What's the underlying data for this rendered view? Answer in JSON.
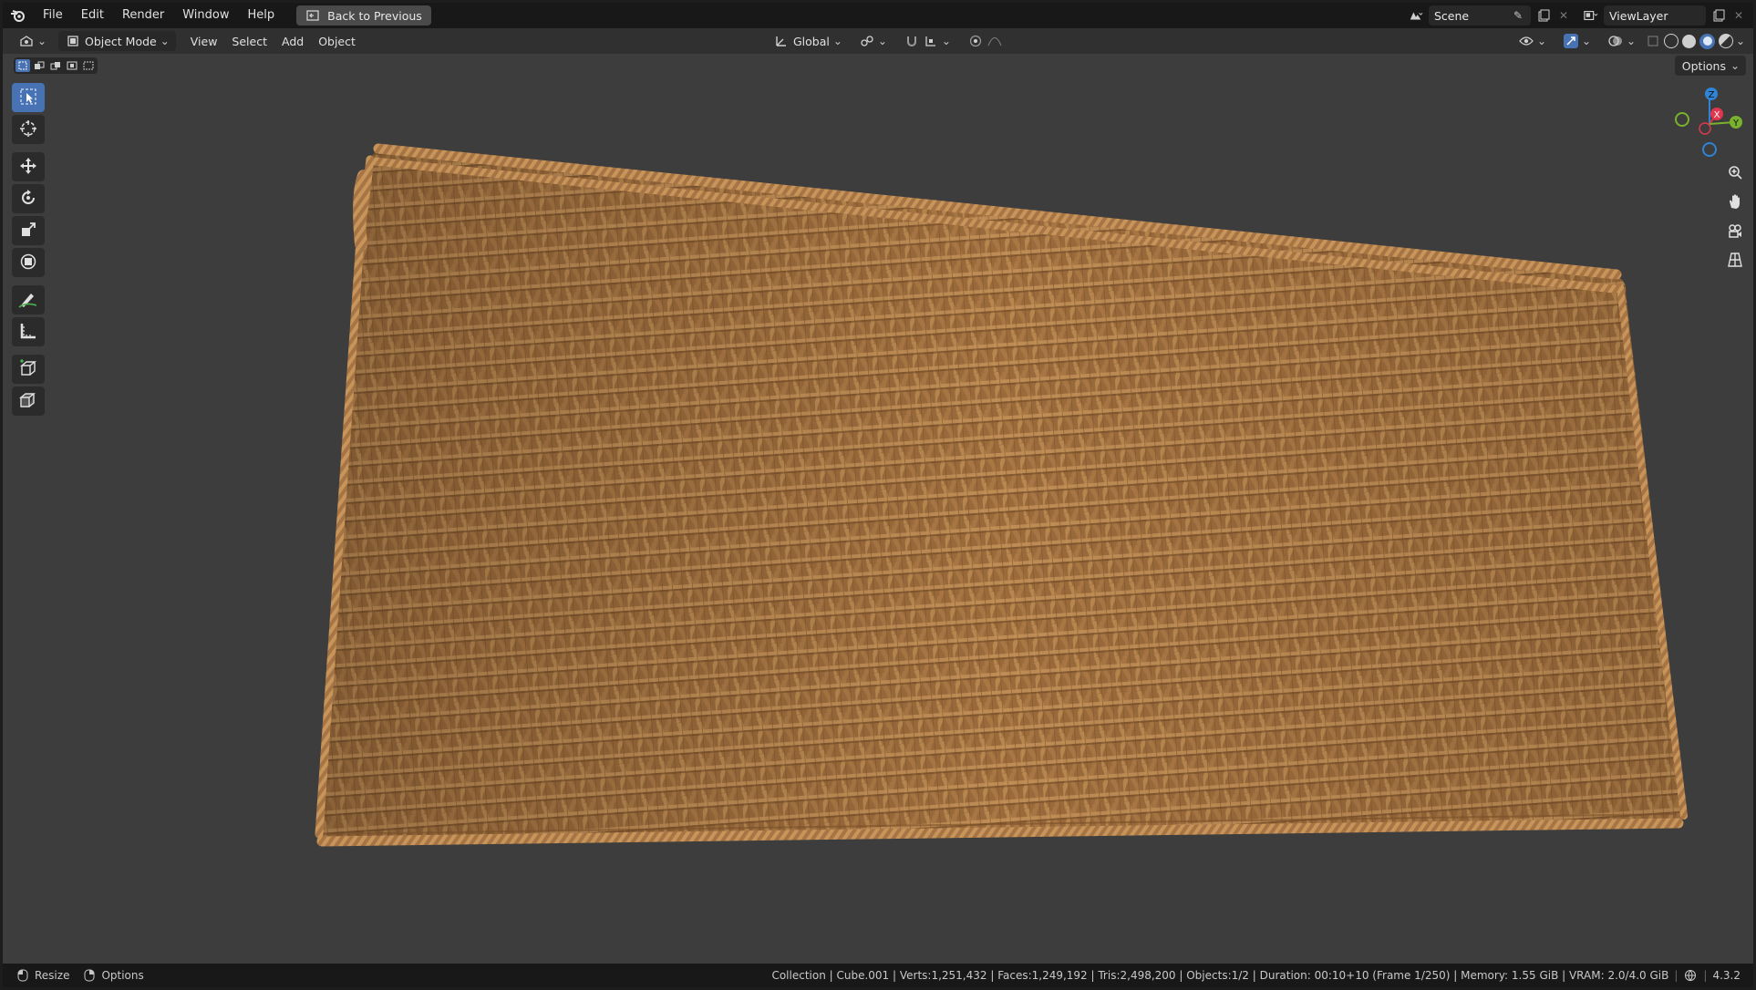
{
  "menu": {
    "file": "File",
    "edit": "Edit",
    "render": "Render",
    "window": "Window",
    "help": "Help"
  },
  "back_button": "Back to Previous",
  "scene_name": "Scene",
  "view_layer": "ViewLayer",
  "header": {
    "mode": "Object Mode",
    "view": "View",
    "select": "Select",
    "add": "Add",
    "object": "Object",
    "orientation": "Global",
    "options": "Options"
  },
  "gizmo": {
    "z": "Z",
    "x": "X",
    "y": "Y"
  },
  "status": {
    "left_action": "Resize",
    "left_options": "Options",
    "info": "Collection | Cube.001 | Verts:1,251,432 | Faces:1,249,192 | Tris:2,498,200 | Objects:1/2 | Duration: 00:10+10 (Frame 1/250) | Memory: 1.55 GiB | VRAM: 2.0/4.0 GiB",
    "version": "4.3.2"
  },
  "colors": {
    "accent": "#4772b3",
    "wicker": "#a0703f",
    "background": "#3d3d3d",
    "axis_x": "#e0364e",
    "axis_y": "#79b22c",
    "axis_z": "#2f84d5"
  }
}
